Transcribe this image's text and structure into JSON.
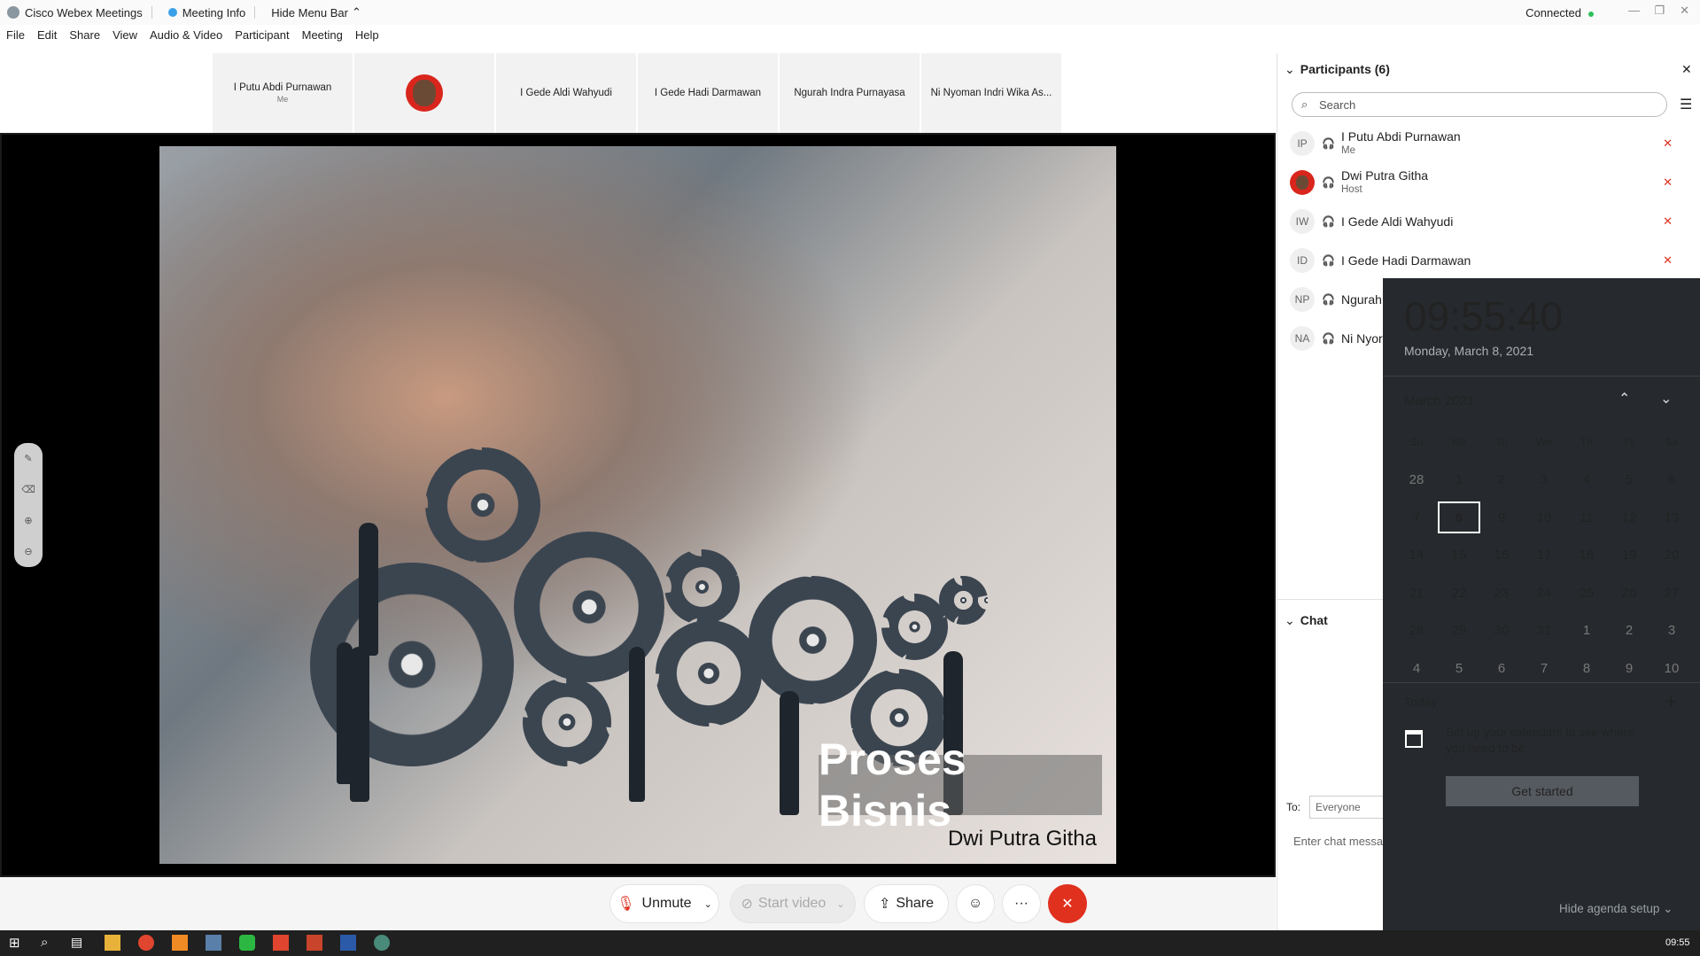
{
  "titlebar": {
    "app_name": "Cisco Webex Meetings",
    "meeting_info": "Meeting Info",
    "hide_menu": "Hide Menu Bar",
    "status": "Connected"
  },
  "menu": [
    "File",
    "Edit",
    "Share",
    "View",
    "Audio & Video",
    "Participant",
    "Meeting",
    "Help"
  ],
  "strip": {
    "tiles": [
      {
        "name": "I Putu Abdi Purnawan",
        "sub": "Me"
      },
      {
        "name": "",
        "sub": ""
      },
      {
        "name": "I Gede Aldi Wahyudi",
        "sub": ""
      },
      {
        "name": "I Gede Hadi Darmawan",
        "sub": ""
      },
      {
        "name": "Ngurah Indra Purnayasa",
        "sub": ""
      },
      {
        "name": "Ni Nyoman Indri Wika As...",
        "sub": ""
      }
    ]
  },
  "slide": {
    "title": "Proses Bisnis",
    "author": "Dwi Putra Githa"
  },
  "controls": {
    "unmute": "Unmute",
    "start_video": "Start video",
    "share": "Share",
    "more": "···"
  },
  "participants": {
    "header": "Participants (6)",
    "search_placeholder": "Search",
    "list": [
      {
        "initials": "IP",
        "name": "I Putu Abdi Purnawan",
        "role": "Me"
      },
      {
        "initials": "",
        "name": "Dwi Putra Githa",
        "role": "Host"
      },
      {
        "initials": "IW",
        "name": "I Gede Aldi Wahyudi",
        "role": ""
      },
      {
        "initials": "ID",
        "name": "I Gede Hadi Darmawan",
        "role": ""
      },
      {
        "initials": "NP",
        "name": "Ngurah",
        "role": ""
      },
      {
        "initials": "NA",
        "name": "Ni Nyor",
        "role": ""
      }
    ]
  },
  "chat": {
    "header": "Chat",
    "to_label": "To:",
    "to_value": "Everyone",
    "input_placeholder": "Enter chat messa"
  },
  "calendar": {
    "time": "09:55:40",
    "date": "Monday, March 8, 2021",
    "month": "March 2021",
    "weekdays": [
      "Su",
      "Mo",
      "Tu",
      "We",
      "Th",
      "Fr",
      "Sa"
    ],
    "weeks": [
      [
        "28",
        "1",
        "2",
        "3",
        "4",
        "5",
        "6"
      ],
      [
        "7",
        "8",
        "9",
        "10",
        "11",
        "12",
        "13"
      ],
      [
        "14",
        "15",
        "16",
        "17",
        "18",
        "19",
        "20"
      ],
      [
        "21",
        "22",
        "23",
        "24",
        "25",
        "26",
        "27"
      ],
      [
        "28",
        "29",
        "30",
        "31",
        "1",
        "2",
        "3"
      ],
      [
        "4",
        "5",
        "6",
        "7",
        "8",
        "9",
        "10"
      ]
    ],
    "selected": "8",
    "today_label": "Today",
    "agenda_message": "Set up your calendars to see where you need to be",
    "get_started": "Get started",
    "hide_agenda": "Hide agenda setup"
  },
  "taskbar": {
    "time": "09:55"
  },
  "colors": {
    "accent_red": "#e0301e",
    "connected_green": "#2dbf5a",
    "calendar_bg": "#262a2e"
  }
}
